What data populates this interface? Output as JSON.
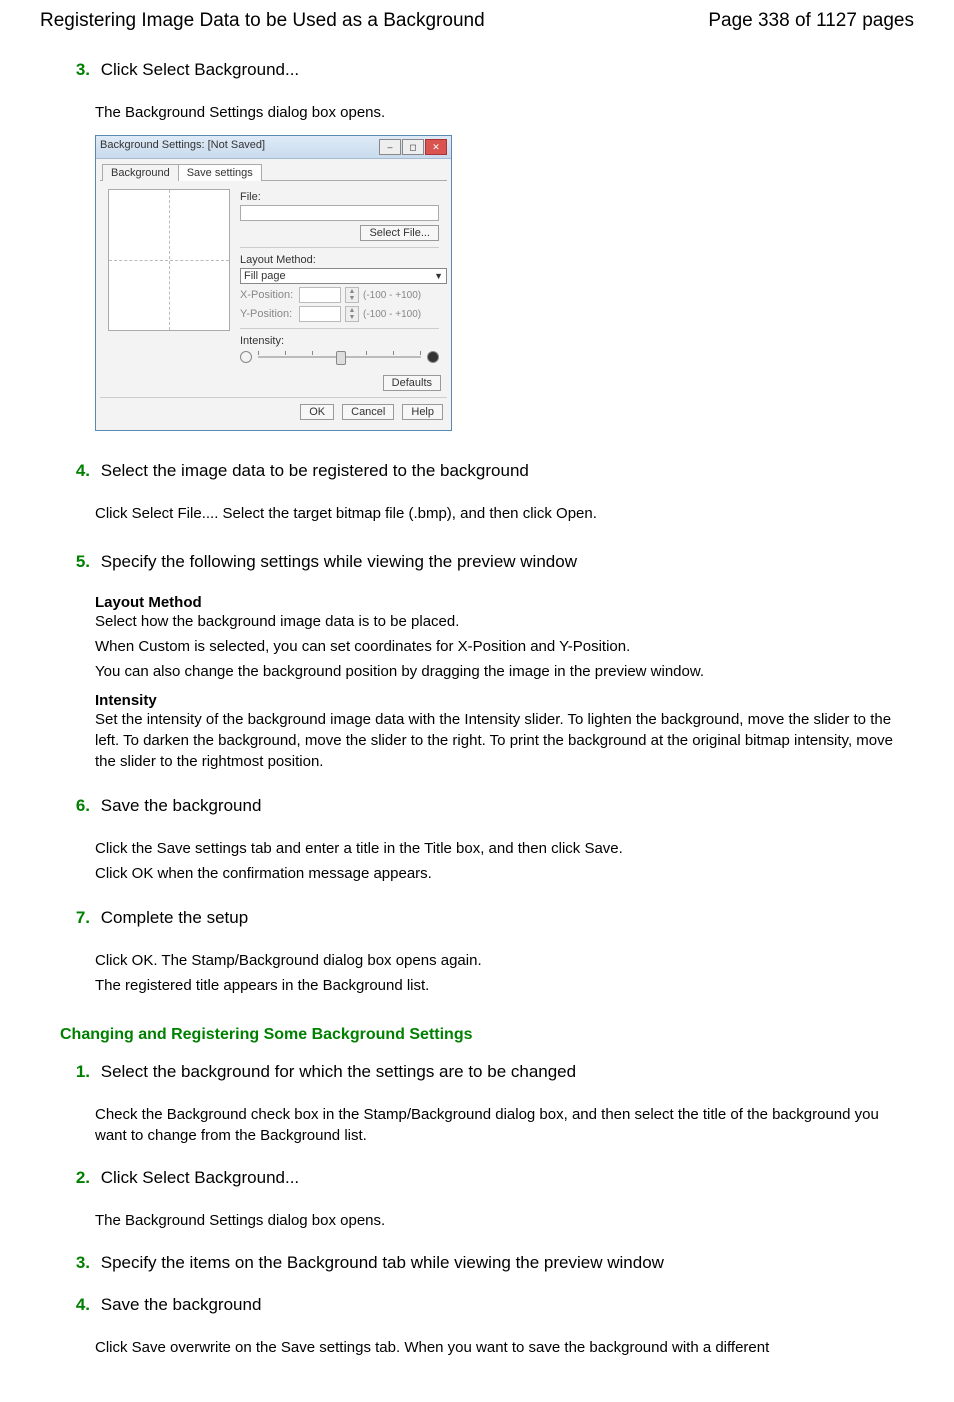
{
  "header": {
    "title": "Registering Image Data to be Used as a Background",
    "page": "Page 338 of 1127 pages"
  },
  "steps": [
    {
      "n": "3.",
      "h": "Click Select Background...",
      "p": [
        "The Background Settings dialog box opens."
      ]
    },
    {
      "n": "4.",
      "h": "Select the image data to be registered to the background",
      "p": [
        "Click Select File.... Select the target bitmap file (.bmp), and then click Open."
      ]
    },
    {
      "n": "5.",
      "h": "Specify the following settings while viewing the preview window",
      "sub": [
        {
          "b": "Layout Method",
          "t": [
            "Select how the background image data is to be placed.",
            "When Custom is selected, you can set coordinates for X-Position and Y-Position.",
            "You can also change the background position by dragging the image in the preview window."
          ]
        },
        {
          "b": "Intensity",
          "t": [
            "Set the intensity of the background image data with the Intensity slider. To lighten the background, move the slider to the left. To darken the background, move the slider to the right. To print the background at the original bitmap intensity, move the slider to the rightmost position."
          ]
        }
      ]
    },
    {
      "n": "6.",
      "h": "Save the background",
      "p": [
        "Click the Save settings tab and enter a title in the Title box, and then click Save.",
        "Click OK when the confirmation message appears."
      ]
    },
    {
      "n": "7.",
      "h": "Complete the setup",
      "p": [
        "Click OK. The Stamp/Background dialog box opens again.",
        "The registered title appears in the Background list."
      ]
    }
  ],
  "section2": "Changing and Registering Some Background Settings",
  "steps2": [
    {
      "n": "1.",
      "h": "Select the background for which the settings are to be changed",
      "p": [
        "Check the Background check box in the Stamp/Background dialog box, and then select the title of the background you want to change from the Background list."
      ]
    },
    {
      "n": "2.",
      "h": "Click Select Background...",
      "p": [
        "The Background Settings dialog box opens."
      ]
    },
    {
      "n": "3.",
      "h": "Specify the items on the Background tab while viewing the preview window"
    },
    {
      "n": "4.",
      "h": "Save the background",
      "p": [
        "Click Save overwrite on the Save settings tab. When you want to save the background with a different"
      ]
    }
  ],
  "dialog": {
    "title": "Background Settings: [Not Saved]",
    "tabs": [
      "Background",
      "Save settings"
    ],
    "file_lbl": "File:",
    "select_file": "Select File...",
    "layout_lbl": "Layout Method:",
    "layout_val": "Fill page",
    "xpos": "X-Position:",
    "ypos": "Y-Position:",
    "range": "(-100 - +100)",
    "intensity": "Intensity:",
    "defaults": "Defaults",
    "ok": "OK",
    "cancel": "Cancel",
    "help": "Help"
  }
}
